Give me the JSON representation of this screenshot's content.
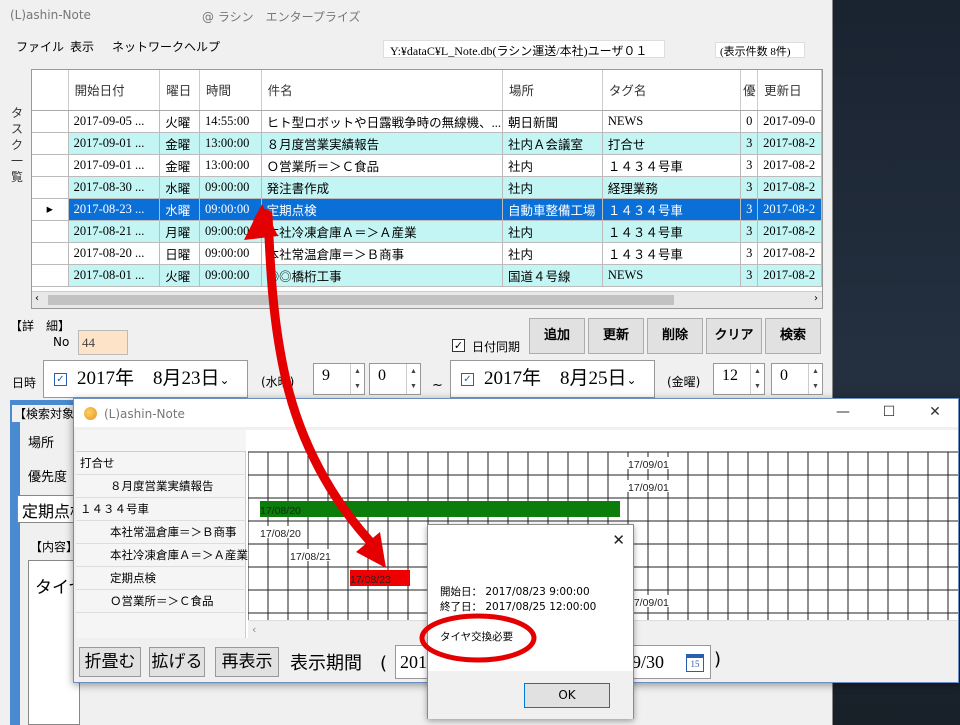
{
  "main": {
    "title": "(L)ashin-Note",
    "company": "@ ラシン　エンタープライズ",
    "menu": [
      "ファイル",
      "表示",
      "ネットワーク",
      "ヘルプ"
    ],
    "db_path": "Y:¥dataC¥L_Note.db(ラシン運送/本社)ユーザ０１",
    "count": "(表示件数 8件)",
    "side_label": [
      "タ",
      "ス",
      "ク",
      "一",
      "覧"
    ]
  },
  "grid": {
    "columns": [
      "開始日付",
      "曜日",
      "時間",
      "件名",
      "場所",
      "タグ名",
      "優",
      "更新日"
    ],
    "selected_marker": "▸",
    "rows": [
      {
        "date": "2017-09-05 ...",
        "dow": "火曜",
        "time": "14:55:00",
        "subject": "ヒト型ロボットや日露戦争時の無線機、...",
        "place": "朝日新聞",
        "tag": "NEWS",
        "prio": "0",
        "updated": "2017-09-0"
      },
      {
        "date": "2017-09-01 ...",
        "dow": "金曜",
        "time": "13:00:00",
        "subject": "８月度営業実績報告",
        "place": "社内Ａ会議室",
        "tag": "打合せ",
        "prio": "3",
        "updated": "2017-08-2"
      },
      {
        "date": "2017-09-01 ...",
        "dow": "金曜",
        "time": "13:00:00",
        "subject": "Ｏ営業所＝＞Ｃ食品",
        "place": "社内",
        "tag": "１４３４号車",
        "prio": "3",
        "updated": "2017-08-2"
      },
      {
        "date": "2017-08-30 ...",
        "dow": "水曜",
        "time": "09:00:00",
        "subject": "発注書作成",
        "place": "社内",
        "tag": "経理業務",
        "prio": "3",
        "updated": "2017-08-2"
      },
      {
        "date": "2017-08-23 ...",
        "dow": "水曜",
        "time": "09:00:00",
        "subject": "定期点検",
        "place": "自動車整備工場",
        "tag": "１４３４号車",
        "prio": "3",
        "updated": "2017-08-2"
      },
      {
        "date": "2017-08-21 ...",
        "dow": "月曜",
        "time": "09:00:00",
        "subject": "本社冷凍倉庫Ａ＝＞Ａ産業",
        "place": "社内",
        "tag": "１４３４号車",
        "prio": "3",
        "updated": "2017-08-2"
      },
      {
        "date": "2017-08-20 ...",
        "dow": "日曜",
        "time": "09:00:00",
        "subject": "本社常温倉庫＝＞Ｂ商事",
        "place": "社内",
        "tag": "１４３４号車",
        "prio": "3",
        "updated": "2017-08-2"
      },
      {
        "date": "2017-08-01 ...",
        "dow": "火曜",
        "time": "09:00:00",
        "subject": "◎◎橋桁工事",
        "place": "国道４号線",
        "tag": "NEWS",
        "prio": "3",
        "updated": "2017-08-2"
      }
    ]
  },
  "detail": {
    "label": "【詳　細】",
    "no_label": "No",
    "no_value": "44",
    "date_sync": "日付同期",
    "buttons": [
      "追加",
      "更新",
      "削除",
      "クリア",
      "検索"
    ],
    "datetime_label": "日時",
    "start_date": "2017年　8月23日",
    "start_dow": "(水曜)",
    "start_hour": "9",
    "start_min": "0",
    "tilde": "~",
    "end_date": "2017年　8月25日",
    "end_dow": "(金曜)",
    "end_hour": "12",
    "end_min": "0"
  },
  "lower": {
    "search_label": "【検索対象",
    "place_label": "場所",
    "prio_label": "優先度",
    "subject_value": "定期点検",
    "content_label": "【内容】",
    "content_value": "タイヤ交換必要"
  },
  "gantt": {
    "title": "(L)ashin-Note",
    "controls": [
      "—",
      "☐",
      "✕"
    ],
    "rows": [
      {
        "label": "打合せ",
        "child": false
      },
      {
        "label": "８月度営業実績報告",
        "child": true
      },
      {
        "label": "１４３４号車",
        "child": false
      },
      {
        "label": "本社常温倉庫＝＞Ｂ商事",
        "child": true
      },
      {
        "label": "本社冷凍倉庫Ａ＝＞Ａ産業",
        "child": true
      },
      {
        "label": "定期点検",
        "child": true
      },
      {
        "label": "Ｏ営業所＝＞Ｃ食品",
        "child": true
      }
    ],
    "bar_labels": [
      "17/09/01",
      "17/09/01",
      "17/08/20",
      "17/08/20",
      "17/08/21",
      "17/08/23",
      "17/09/01"
    ],
    "buttons": [
      "折畳む",
      "拡げる",
      "再表示"
    ],
    "period_label": "表示期間　(",
    "period_start": "201",
    "period_end": "9/30",
    "period_close": ")",
    "colors": {
      "bar_green": "#0a7d0a",
      "bar_red": "#ee0000"
    }
  },
  "dialog": {
    "close": "✕",
    "start": "開始日： 2017/08/23 9:00:00",
    "end": "終了日： 2017/08/25 12:00:00",
    "content": "タイヤ交換必要",
    "ok": "OK"
  },
  "annotation": {
    "color": "#ee0000"
  }
}
